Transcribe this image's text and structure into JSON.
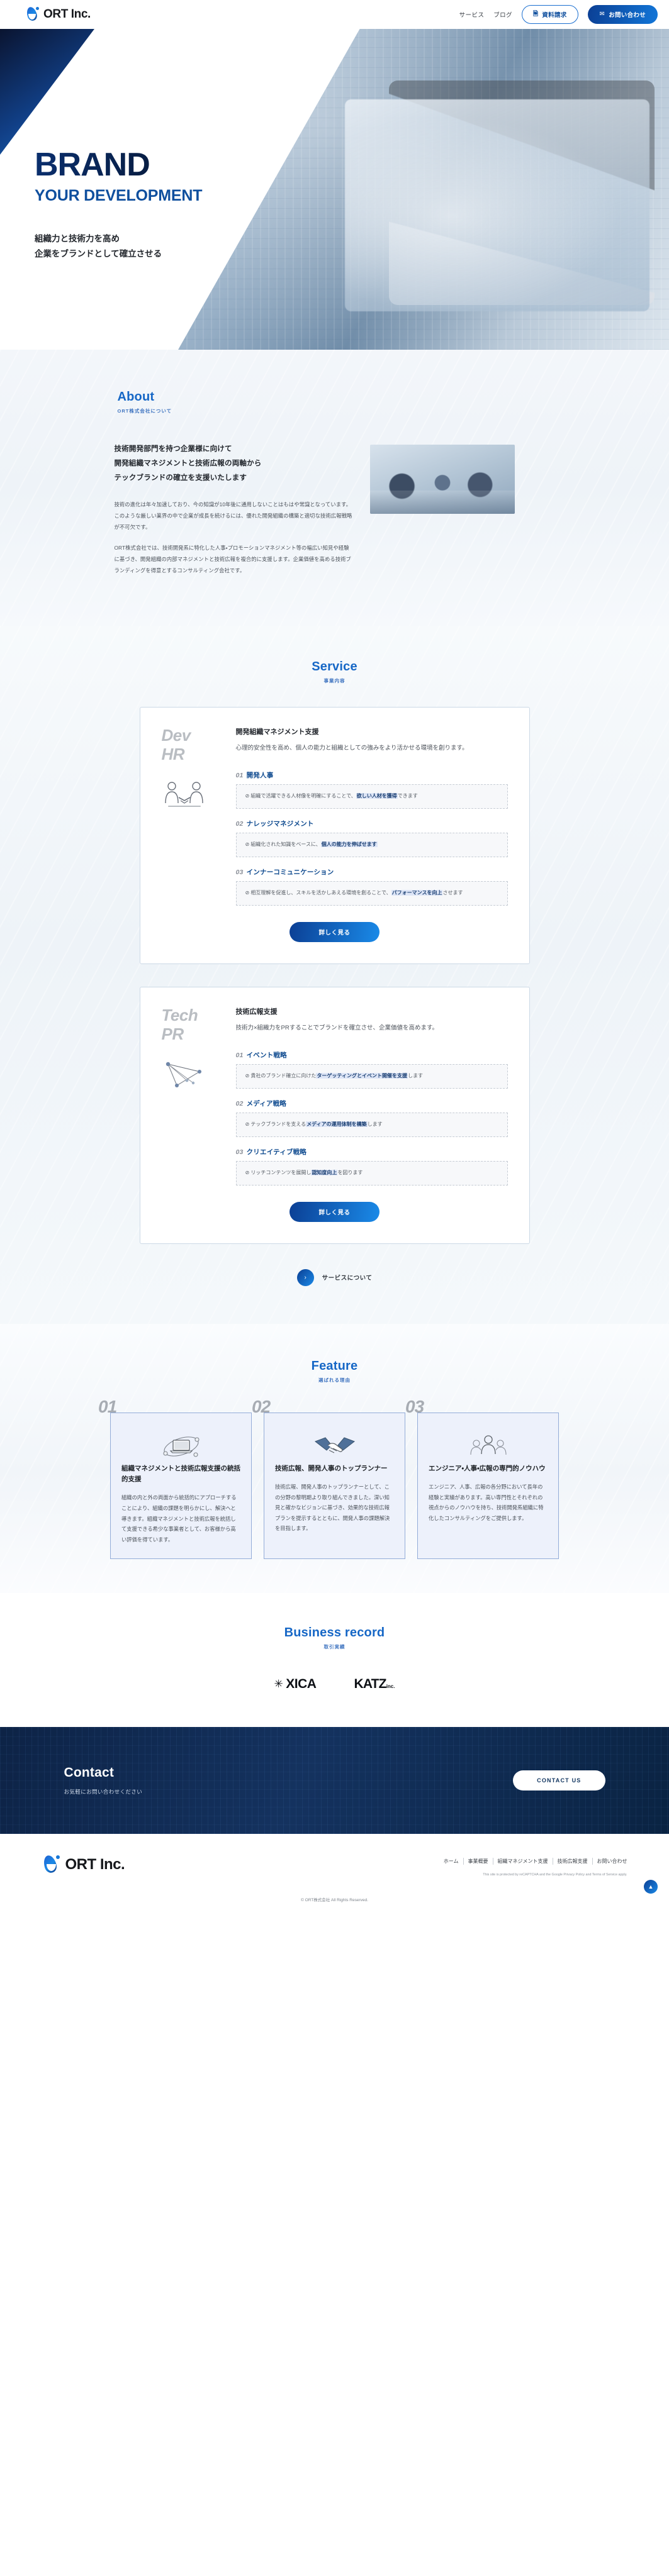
{
  "header": {
    "brand": "ORT Inc.",
    "nav_links": [
      "サービス",
      "ブログ"
    ],
    "doc_button": "資料請求",
    "contact_button": "お問い合わせ"
  },
  "hero": {
    "title": "BRAND",
    "subtitle": "YOUR DEVELOPMENT",
    "lead_line1": "組織力と技術力を高め",
    "lead_line2": "企業をブランドとして確立させる"
  },
  "about": {
    "en": "About",
    "jp": "ORT株式会社について",
    "heading_line1": "技術開発部門を持つ企業様に向けて",
    "heading_line2": "開発組織マネジメントと技術広報の両軸から",
    "heading_line3": "テックブランドの確立を支援いたします",
    "p1": "技術の進化は年々加速しており、今の知識が10年後に通用しないことはもはや常識となっています。このような厳しい業界の中で企業が成長を続けるには、優れた開発組織の構築と適切な技術広報戦略が不可欠です。",
    "p2": "ORT株式会社では、技術開発系に特化した人事・プロモーションマネジメント等の幅広い知見や経験に基づき、開発組織の内部マネジメントと技術広報を複合的に支援します。企業価値を高める技術ブランディングを得意とするコンサルティング会社です。"
  },
  "service": {
    "en": "Service",
    "jp": "事業内容",
    "cards": [
      {
        "badge_line1": "Dev",
        "badge_line2": "HR",
        "icon": "handshake-people-icon",
        "title": "開発組織マネジメント支援",
        "desc": "心理的安全性を高め、個人の能力と組織としての強みをより活かせる環境を創ります。",
        "items": [
          {
            "num": "01",
            "name": "開発人事",
            "text_pre": "⊘ 組織で活躍できる人材像を明確にすることで、",
            "text_hl": "欲しい人材を獲得",
            "text_post": "できます"
          },
          {
            "num": "02",
            "name": "ナレッジマネジメント",
            "text_pre": "⊘ 組織化された知識をベースに、",
            "text_hl": "個人の能力を伸ばせます",
            "text_post": ""
          },
          {
            "num": "03",
            "name": "インナーコミュニケーション",
            "text_pre": "⊘ 相互理解を促進し、スキルを活かしあえる環境を創ることで、",
            "text_hl": "パフォーマンスを向上",
            "text_post": "させます"
          }
        ],
        "button": "詳しく見る"
      },
      {
        "badge_line1": "Tech",
        "badge_line2": "PR",
        "icon": "network-nodes-icon",
        "title": "技術広報支援",
        "desc": "技術力×組織力をPRすることでブランドを確立させ、企業価値を高めます。",
        "items": [
          {
            "num": "01",
            "name": "イベント戦略",
            "text_pre": "⊘ 貴社のブランド確立に向けた",
            "text_hl": "ターゲッティングとイベント開催を支援",
            "text_post": "します"
          },
          {
            "num": "02",
            "name": "メディア戦略",
            "text_pre": "⊘ テックブランドを支える",
            "text_hl": "メディアの運用体制を構築",
            "text_post": "します"
          },
          {
            "num": "03",
            "name": "クリエイティブ戦略",
            "text_pre": "⊘ リッチコンテンツを展開し",
            "text_hl": "認知度向上",
            "text_post": "を図ります"
          }
        ],
        "button": "詳しく見る"
      }
    ],
    "more_label": "サービスについて",
    "more_icon": "chevron-right-icon"
  },
  "feature": {
    "en": "Feature",
    "jp": "選ばれる理由",
    "cards": [
      {
        "num": "01",
        "icon": "laptop-orbit-icon",
        "title": "組織マネジメントと技術広報支援の統括的支援",
        "body": "組織の内と外の両面から統括的にアプローチすることにより、組織の課題を明らかにし、解決へと導きます。組織マネジメントと技術広報を統括して支援できる希少な事業者として、お客様から高い評価を得ています。"
      },
      {
        "num": "02",
        "icon": "handshake-icon",
        "title": "技術広報、開発人事のトップランナー",
        "body": "技術広報、開発人事のトップランナーとして、この分野の黎明期より取り組んできました。深い知見と確かなビジョンに基づき、効果的な技術広報プランを提示するとともに、開発人事の課題解決を目指します。"
      },
      {
        "num": "03",
        "icon": "people-gear-icon",
        "title": "エンジニア・人事・広報の専門的ノウハウ",
        "body": "エンジニア、人事、広報の各分野において長年の経験と実績があります。高い専門性とそれぞれの視点からのノウハウを持ち、技術開発系組織に特化したコンサルティングをご提供します。"
      }
    ]
  },
  "record": {
    "en": "Business record",
    "jp": "取引実績",
    "logos": [
      {
        "name": "XICA",
        "mark": "✳"
      },
      {
        "name": "KATZ",
        "suffix": "inc."
      }
    ]
  },
  "contact": {
    "heading": "Contact",
    "sub": "お気軽にお問い合わせください",
    "button": "CONTACT US"
  },
  "footer": {
    "brand": "ORT Inc.",
    "nav": [
      "ホーム",
      "事業概要",
      "組織マネジメント支援",
      "技術広報支援",
      "お問い合わせ"
    ],
    "note": "This site is protected by reCAPTCHA and the Google Privacy Policy and Terms of Service apply.",
    "copyright": "© ORT株式会社 All Rights Reserved.",
    "totop_icon": "arrow-up-icon"
  }
}
